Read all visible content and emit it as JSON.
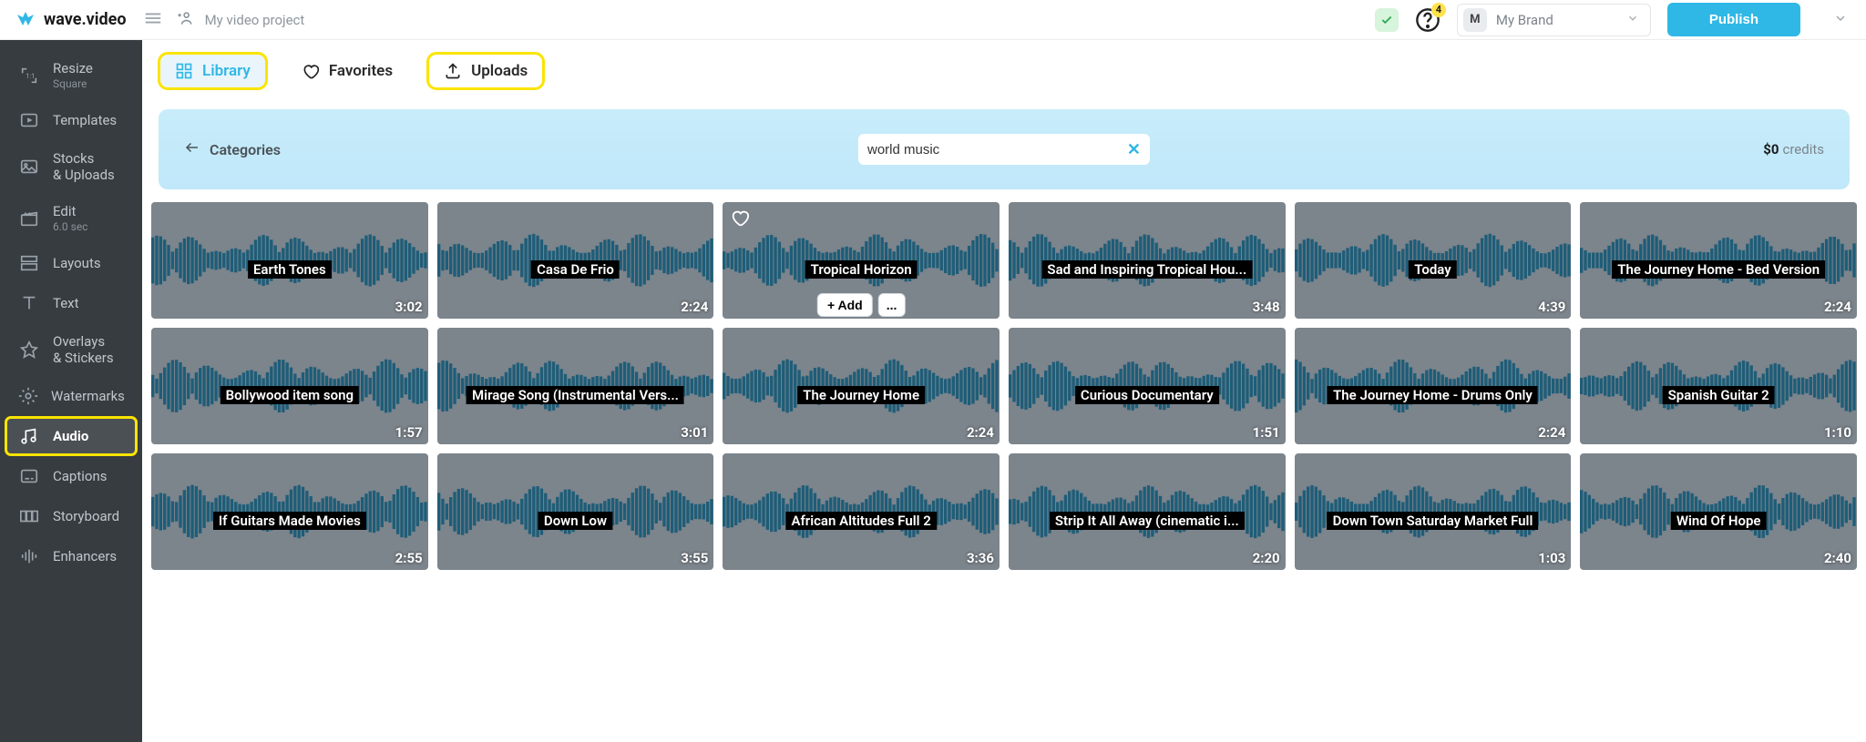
{
  "header": {
    "app_name": "wave.video",
    "project_name": "My video project",
    "help_badge": "4",
    "brand_chip": "M",
    "brand_name": "My Brand",
    "publish": "Publish"
  },
  "sidebar": {
    "items": [
      {
        "label": "Resize",
        "sub": "Square",
        "icon": "resize"
      },
      {
        "label": "Templates",
        "icon": "template"
      },
      {
        "label": "Stocks\n& Uploads",
        "icon": "image"
      },
      {
        "label": "Edit",
        "sub": "6.0 sec",
        "icon": "clapper"
      },
      {
        "label": "Layouts",
        "icon": "layout"
      },
      {
        "label": "Text",
        "icon": "text"
      },
      {
        "label": "Overlays\n& Stickers",
        "icon": "star"
      },
      {
        "label": "Watermarks",
        "icon": "gear"
      },
      {
        "label": "Audio",
        "icon": "music",
        "active": true,
        "highlight": true
      },
      {
        "label": "Captions",
        "icon": "captions"
      },
      {
        "label": "Storyboard",
        "icon": "storyboard"
      },
      {
        "label": "Enhancers",
        "icon": "wave"
      }
    ]
  },
  "tabs": {
    "library": "Library",
    "favorites": "Favorites",
    "uploads": "Uploads"
  },
  "banner": {
    "categories": "Categories",
    "search_value": "world music",
    "credits_amount": "$0",
    "credits_label": "credits"
  },
  "actions": {
    "add": "Add",
    "more": "..."
  },
  "tracks": [
    {
      "title": "Earth Tones",
      "dur": "3:02"
    },
    {
      "title": "Casa De Frio",
      "dur": "2:24"
    },
    {
      "title": "Tropical Horizon",
      "dur": "",
      "hover": true
    },
    {
      "title": "Sad and Inspiring Tropical Hou...",
      "dur": "3:48"
    },
    {
      "title": "Today",
      "dur": "4:39"
    },
    {
      "title": "The Journey Home - Bed Version",
      "dur": "2:24"
    },
    {
      "title": "Bollywood item song",
      "dur": "1:57"
    },
    {
      "title": "Mirage Song (Instrumental Vers...",
      "dur": "3:01"
    },
    {
      "title": "The Journey Home",
      "dur": "2:24"
    },
    {
      "title": "Curious Documentary",
      "dur": "1:51"
    },
    {
      "title": "The Journey Home - Drums Only",
      "dur": "2:24"
    },
    {
      "title": "Spanish Guitar 2",
      "dur": "1:10"
    },
    {
      "title": "If Guitars Made Movies",
      "dur": "2:55"
    },
    {
      "title": "Down Low",
      "dur": "3:55"
    },
    {
      "title": "African Altitudes Full 2",
      "dur": "3:36"
    },
    {
      "title": "Strip It All Away (cinematic i...",
      "dur": "2:20"
    },
    {
      "title": "Down Town Saturday Market Full",
      "dur": "1:03"
    },
    {
      "title": "Wind Of Hope",
      "dur": "2:40"
    }
  ]
}
